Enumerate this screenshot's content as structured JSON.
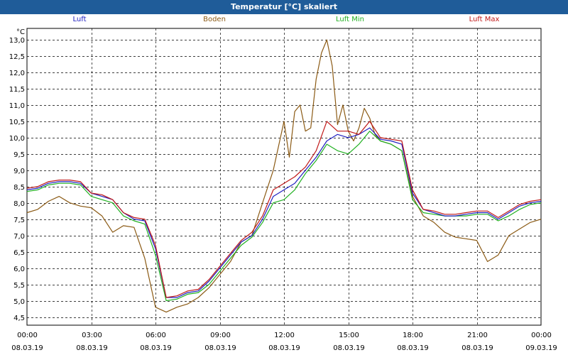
{
  "window": {
    "title": "Temperatur [°C] skaliert"
  },
  "chart_data": {
    "type": "line",
    "title": "Temperatur [°C] skaliert",
    "y_unit_label": "°C",
    "ylim": [
      4.25,
      13.35
    ],
    "y_ticks": [
      4.5,
      5.0,
      5.5,
      6.0,
      6.5,
      7.0,
      7.5,
      8.0,
      8.5,
      9.0,
      9.5,
      10.0,
      10.5,
      11.0,
      11.5,
      12.0,
      12.5,
      13.0
    ],
    "y_tick_labels": [
      "4,5",
      "5,0",
      "5,5",
      "6,0",
      "6,5",
      "7,0",
      "7,5",
      "8,0",
      "8,5",
      "9,0",
      "9,5",
      "10,0",
      "10,5",
      "11,0",
      "11,5",
      "12,0",
      "12,5",
      "13,0"
    ],
    "xlim": [
      0,
      24
    ],
    "x_ticks": [
      0,
      3,
      6,
      9,
      12,
      15,
      18,
      21,
      24
    ],
    "x_tick_labels": [
      {
        "time": "00:00",
        "date": "08.03.19"
      },
      {
        "time": "03:00",
        "date": "08.03.19"
      },
      {
        "time": "06:00",
        "date": "08.03.19"
      },
      {
        "time": "09:00",
        "date": "08.03.19"
      },
      {
        "time": "12:00",
        "date": "08.03.19"
      },
      {
        "time": "15:00",
        "date": "08.03.19"
      },
      {
        "time": "18:00",
        "date": "08.03.19"
      },
      {
        "time": "21:00",
        "date": "08.03.19"
      },
      {
        "time": "00:00",
        "date": "09.03.19"
      }
    ],
    "grid": true,
    "legend_position": "top",
    "series": [
      {
        "name": "Luft",
        "color": "#2020c0",
        "x": [
          0,
          0.5,
          1,
          1.5,
          2,
          2.5,
          3,
          3.5,
          4,
          4.5,
          5,
          5.5,
          6,
          6.5,
          7,
          7.5,
          8,
          8.5,
          9,
          9.5,
          10,
          10.5,
          11,
          11.5,
          12,
          12.5,
          13,
          13.5,
          14,
          14.5,
          15,
          15.5,
          16,
          16.5,
          17,
          17.5,
          18,
          18.5,
          19,
          19.5,
          20,
          20.5,
          21,
          21.5,
          22,
          22.5,
          23,
          23.5,
          24
        ],
        "y": [
          8.4,
          8.45,
          8.6,
          8.65,
          8.65,
          8.6,
          8.3,
          8.2,
          8.1,
          7.7,
          7.5,
          7.45,
          6.6,
          5.1,
          5.1,
          5.25,
          5.3,
          5.6,
          6.0,
          6.4,
          6.8,
          7.0,
          7.5,
          8.2,
          8.4,
          8.6,
          9.0,
          9.4,
          9.9,
          10.1,
          10.0,
          10.1,
          10.3,
          9.95,
          9.9,
          9.8,
          8.3,
          7.8,
          7.7,
          7.6,
          7.6,
          7.65,
          7.7,
          7.7,
          7.5,
          7.7,
          7.9,
          8.0,
          8.05
        ]
      },
      {
        "name": "Boden",
        "color": "#8b5a14",
        "x": [
          0,
          0.5,
          1,
          1.5,
          2,
          2.5,
          3,
          3.5,
          4,
          4.5,
          5,
          5.5,
          6,
          6.5,
          7,
          7.5,
          8,
          8.5,
          9,
          9.5,
          10,
          10.5,
          11,
          11.5,
          12,
          12.25,
          12.5,
          12.75,
          13,
          13.25,
          13.5,
          13.75,
          14,
          14.25,
          14.5,
          14.75,
          15,
          15.25,
          15.5,
          15.75,
          16,
          16.25,
          16.5,
          17,
          17.5,
          18,
          18.5,
          19,
          19.5,
          20,
          20.5,
          21,
          21.5,
          22,
          22.5,
          23,
          23.5,
          24
        ],
        "y": [
          7.7,
          7.8,
          8.05,
          8.2,
          8.0,
          7.9,
          7.85,
          7.6,
          7.1,
          7.3,
          7.25,
          6.3,
          4.8,
          4.65,
          4.8,
          4.9,
          5.1,
          5.4,
          5.8,
          6.2,
          6.8,
          7.0,
          8.0,
          9.0,
          10.5,
          9.4,
          10.8,
          11.0,
          10.2,
          10.3,
          11.8,
          12.6,
          13.0,
          12.2,
          10.4,
          11.0,
          10.2,
          9.9,
          10.3,
          10.9,
          10.6,
          10.1,
          9.9,
          9.8,
          9.6,
          8.2,
          7.6,
          7.4,
          7.1,
          6.95,
          6.9,
          6.85,
          6.2,
          6.4,
          7.0,
          7.2,
          7.4,
          7.5
        ]
      },
      {
        "name": "Luft Min",
        "color": "#20b020",
        "x": [
          0,
          0.5,
          1,
          1.5,
          2,
          2.5,
          3,
          3.5,
          4,
          4.5,
          5,
          5.5,
          6,
          6.5,
          7,
          7.5,
          8,
          8.5,
          9,
          9.5,
          10,
          10.5,
          11,
          11.5,
          12,
          12.5,
          13,
          13.5,
          14,
          14.5,
          15,
          15.5,
          16,
          16.5,
          17,
          17.5,
          18,
          18.5,
          19,
          19.5,
          20,
          20.5,
          21,
          21.5,
          22,
          22.5,
          23,
          23.5,
          24
        ],
        "y": [
          8.35,
          8.4,
          8.55,
          8.6,
          8.6,
          8.55,
          8.2,
          8.1,
          8.0,
          7.6,
          7.45,
          7.35,
          6.4,
          5.0,
          5.05,
          5.2,
          5.25,
          5.5,
          5.9,
          6.3,
          6.7,
          6.95,
          7.4,
          8.0,
          8.1,
          8.4,
          8.9,
          9.3,
          9.8,
          9.6,
          9.5,
          9.8,
          10.2,
          9.9,
          9.8,
          9.6,
          8.1,
          7.7,
          7.65,
          7.6,
          7.6,
          7.6,
          7.65,
          7.65,
          7.45,
          7.6,
          7.8,
          7.95,
          8.0
        ]
      },
      {
        "name": "Luft Max",
        "color": "#c01818",
        "x": [
          0,
          0.5,
          1,
          1.5,
          2,
          2.5,
          3,
          3.5,
          4,
          4.5,
          5,
          5.5,
          6,
          6.5,
          7,
          7.5,
          8,
          8.5,
          9,
          9.5,
          10,
          10.5,
          11,
          11.5,
          12,
          12.5,
          13,
          13.5,
          14,
          14.5,
          15,
          15.5,
          16,
          16.5,
          17,
          17.5,
          18,
          18.5,
          19,
          19.5,
          20,
          20.5,
          21,
          21.5,
          22,
          22.5,
          23,
          23.5,
          24
        ],
        "y": [
          8.45,
          8.5,
          8.65,
          8.7,
          8.7,
          8.65,
          8.3,
          8.25,
          8.1,
          7.7,
          7.55,
          7.5,
          6.7,
          5.1,
          5.15,
          5.3,
          5.35,
          5.65,
          6.05,
          6.45,
          6.85,
          7.1,
          7.6,
          8.4,
          8.6,
          8.8,
          9.1,
          9.6,
          10.5,
          10.2,
          10.2,
          10.1,
          10.5,
          10.0,
          9.95,
          9.9,
          8.4,
          7.8,
          7.75,
          7.65,
          7.65,
          7.7,
          7.75,
          7.75,
          7.55,
          7.75,
          7.95,
          8.05,
          8.1
        ]
      }
    ]
  }
}
